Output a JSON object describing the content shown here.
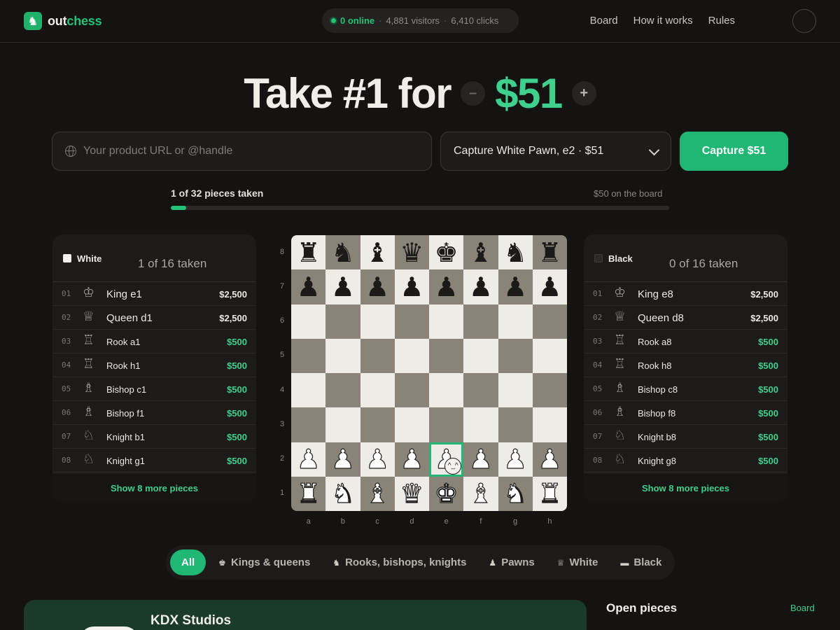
{
  "brand": {
    "part1": "out",
    "part2": "chess",
    "logo_icon": "knight-icon",
    "color": "#23c277"
  },
  "stats": {
    "online": "0 online",
    "visitors": "4,881 visitors",
    "clicks": "6,410 clicks",
    "separator": "·"
  },
  "nav": {
    "board": "Board",
    "how": "How it works",
    "rules": "Rules"
  },
  "hero": {
    "title": "Take #1 for",
    "price": "$51",
    "minus": "–",
    "plus": "+"
  },
  "form": {
    "url_placeholder": "Your product URL or @handle",
    "url_value": "",
    "selected_piece": "Capture White Pawn, e2 · $51",
    "capture_label": "Capture $51"
  },
  "progress": {
    "label": "1 of 32 pieces taken",
    "right": "$50 on the board",
    "fraction": 0.03125
  },
  "white_panel": {
    "side": "White",
    "taken": "1 of 16 taken",
    "more": "Show 8 more pieces",
    "rows": [
      {
        "num": "01",
        "icon": "♔",
        "name": "King e1",
        "price": "$2,500",
        "royal": true
      },
      {
        "num": "02",
        "icon": "♕",
        "name": "Queen d1",
        "price": "$2,500",
        "royal": true
      },
      {
        "num": "03",
        "icon": "♖",
        "name": "Rook a1",
        "price": "$500",
        "royal": false
      },
      {
        "num": "04",
        "icon": "♖",
        "name": "Rook h1",
        "price": "$500",
        "royal": false
      },
      {
        "num": "05",
        "icon": "♗",
        "name": "Bishop c1",
        "price": "$500",
        "royal": false
      },
      {
        "num": "06",
        "icon": "♗",
        "name": "Bishop f1",
        "price": "$500",
        "royal": false
      },
      {
        "num": "07",
        "icon": "♘",
        "name": "Knight b1",
        "price": "$500",
        "royal": false
      },
      {
        "num": "08",
        "icon": "♘",
        "name": "Knight g1",
        "price": "$500",
        "royal": false
      }
    ]
  },
  "black_panel": {
    "side": "Black",
    "taken": "0 of 16 taken",
    "more": "Show 8 more pieces",
    "rows": [
      {
        "num": "01",
        "icon": "♔",
        "name": "King e8",
        "price": "$2,500",
        "royal": true
      },
      {
        "num": "02",
        "icon": "♕",
        "name": "Queen d8",
        "price": "$2,500",
        "royal": true
      },
      {
        "num": "03",
        "icon": "♖",
        "name": "Rook a8",
        "price": "$500",
        "royal": false
      },
      {
        "num": "04",
        "icon": "♖",
        "name": "Rook h8",
        "price": "$500",
        "royal": false
      },
      {
        "num": "05",
        "icon": "♗",
        "name": "Bishop c8",
        "price": "$500",
        "royal": false
      },
      {
        "num": "06",
        "icon": "♗",
        "name": "Bishop f8",
        "price": "$500",
        "royal": false
      },
      {
        "num": "07",
        "icon": "♘",
        "name": "Knight b8",
        "price": "$500",
        "royal": false
      },
      {
        "num": "08",
        "icon": "♘",
        "name": "Knight g8",
        "price": "$500",
        "royal": false
      }
    ]
  },
  "board": {
    "files": [
      "a",
      "b",
      "c",
      "d",
      "e",
      "f",
      "g",
      "h"
    ],
    "ranks": [
      "8",
      "7",
      "6",
      "5",
      "4",
      "3",
      "2",
      "1"
    ],
    "position": [
      "rnbqkbnr",
      "pppppppp",
      "........",
      "........",
      "........",
      "........",
      "PPPPPPPP",
      "RNBQKBNR"
    ],
    "captured_square": "e2",
    "captured_marker": "^_^",
    "light_color": "#efebe6",
    "dark_color": "#8a8478"
  },
  "filters": [
    {
      "label": "All",
      "icon": "",
      "active": true
    },
    {
      "label": "Kings & queens",
      "icon": "♚",
      "active": false
    },
    {
      "label": "Rooks, bishops, knights",
      "icon": "♞",
      "active": false
    },
    {
      "label": "Pawns",
      "icon": "♟",
      "active": false
    },
    {
      "label": "White",
      "icon": "♕",
      "active": false
    },
    {
      "label": "Black",
      "icon": "▬",
      "active": false
    }
  ],
  "featured": {
    "name": "KDX Studios"
  },
  "open_pieces": {
    "title": "Open pieces",
    "link": "Board"
  }
}
